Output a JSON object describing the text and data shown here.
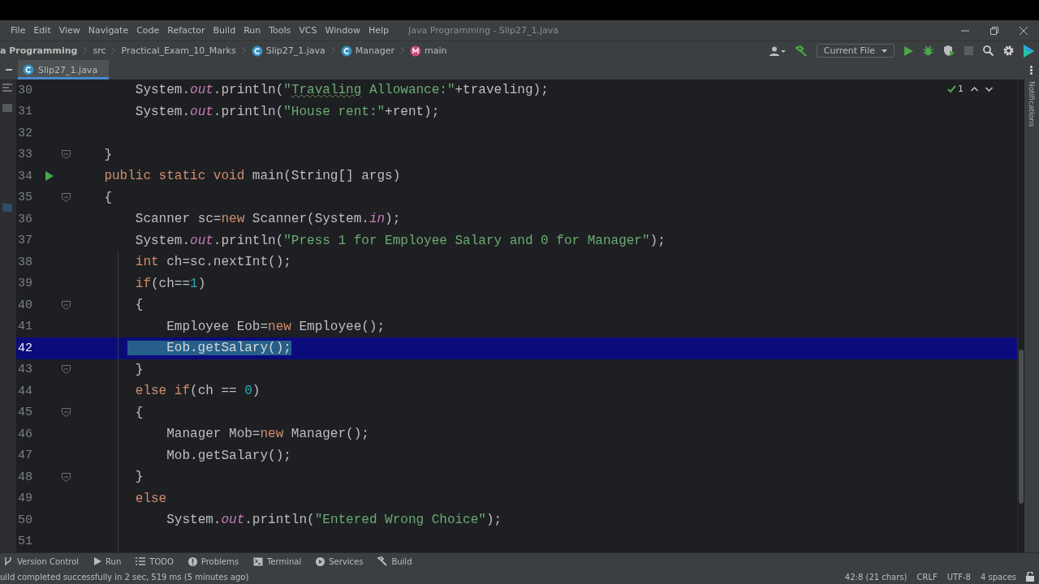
{
  "menu": [
    "File",
    "Edit",
    "View",
    "Navigate",
    "Code",
    "Refactor",
    "Build",
    "Run",
    "Tools",
    "VCS",
    "Window",
    "Help"
  ],
  "window": {
    "title": "Java Programming - Slip27_1.java"
  },
  "breadcrumbs": [
    {
      "label": "a Programming",
      "kind": "project"
    },
    {
      "label": "src",
      "kind": "folder"
    },
    {
      "label": "Practical_Exam_10_Marks",
      "kind": "folder"
    },
    {
      "label": "Slip27_1.java",
      "kind": "class"
    },
    {
      "label": "Manager",
      "kind": "class"
    },
    {
      "label": "main",
      "kind": "method"
    }
  ],
  "run_config": "Current File",
  "tabs": [
    {
      "label": "Slip27_1.java",
      "selected": true
    }
  ],
  "inspection": {
    "count": "1"
  },
  "lines": [
    {
      "number": "30",
      "kind": "plain",
      "selected": false,
      "tokens": [
        {
          "text": "        System.",
          "kind": "plain"
        },
        {
          "text": "out",
          "kind": "field"
        },
        {
          "text": ".println(",
          "kind": "plain"
        },
        {
          "text": "\"",
          "kind": "string"
        },
        {
          "text": "Travaling",
          "kind": "typo"
        },
        {
          "text": " Allowance:\"",
          "kind": "string"
        },
        {
          "text": "+traveling);",
          "kind": "plain"
        }
      ]
    },
    {
      "number": "31",
      "kind": "plain",
      "selected": false,
      "tokens": [
        {
          "text": "        System.",
          "kind": "plain"
        },
        {
          "text": "out",
          "kind": "field"
        },
        {
          "text": ".println(",
          "kind": "plain"
        },
        {
          "text": "\"House rent:\"",
          "kind": "string"
        },
        {
          "text": "+rent);",
          "kind": "plain"
        }
      ]
    },
    {
      "number": "32",
      "kind": "plain",
      "selected": false
    },
    {
      "number": "33",
      "kind": "fold",
      "selected": false,
      "tokens": [
        {
          "text": "    }",
          "kind": "plain"
        }
      ]
    },
    {
      "number": "34",
      "kind": "run",
      "selected": false,
      "tokens": [
        {
          "text": "    public static void ",
          "kind": "keyword"
        },
        {
          "text": "main(String[] args)",
          "kind": "plain"
        }
      ]
    },
    {
      "number": "35",
      "kind": "fold",
      "selected": false,
      "tokens": [
        {
          "text": "    {",
          "kind": "plain"
        }
      ]
    },
    {
      "number": "36",
      "kind": "plain",
      "selected": false,
      "tokens": [
        {
          "text": "        Scanner sc=",
          "kind": "plain"
        },
        {
          "text": "new ",
          "kind": "keyword"
        },
        {
          "text": "Scanner(System.",
          "kind": "plain"
        },
        {
          "text": "in",
          "kind": "field"
        },
        {
          "text": ");",
          "kind": "plain"
        }
      ]
    },
    {
      "number": "37",
      "kind": "plain",
      "selected": false,
      "tokens": [
        {
          "text": "        System.",
          "kind": "plain"
        },
        {
          "text": "out",
          "kind": "field"
        },
        {
          "text": ".println(",
          "kind": "plain"
        },
        {
          "text": "\"Press 1 for Employee Salary and 0 for Manager\"",
          "kind": "string"
        },
        {
          "text": ");",
          "kind": "plain"
        }
      ]
    },
    {
      "number": "38",
      "kind": "plain",
      "selected": false,
      "tokens": [
        {
          "text": "        int ",
          "kind": "keyword"
        },
        {
          "text": "ch=sc.nextInt();",
          "kind": "plain"
        }
      ]
    },
    {
      "number": "39",
      "kind": "plain",
      "selected": false,
      "tokens": [
        {
          "text": "        if",
          "kind": "keyword"
        },
        {
          "text": "(ch==",
          "kind": "plain"
        },
        {
          "text": "1",
          "kind": "number"
        },
        {
          "text": ")",
          "kind": "plain"
        }
      ]
    },
    {
      "number": "40",
      "kind": "fold",
      "selected": false,
      "tokens": [
        {
          "text": "        {",
          "kind": "plain"
        }
      ]
    },
    {
      "number": "41",
      "kind": "plain",
      "selected": false,
      "tokens": [
        {
          "text": "            Employee Eob=",
          "kind": "plain"
        },
        {
          "text": "new ",
          "kind": "keyword"
        },
        {
          "text": "Employee();",
          "kind": "plain"
        }
      ]
    },
    {
      "number": "42",
      "kind": "plain",
      "selected": true,
      "tokens": [
        {
          "text": "     Eob.getSalary();",
          "kind": "selection"
        }
      ]
    },
    {
      "number": "43",
      "kind": "fold",
      "selected": false,
      "tokens": [
        {
          "text": "        }",
          "kind": "plain"
        }
      ]
    },
    {
      "number": "44",
      "kind": "plain",
      "selected": false,
      "tokens": [
        {
          "text": "        else if",
          "kind": "keyword"
        },
        {
          "text": "(ch == ",
          "kind": "plain"
        },
        {
          "text": "0",
          "kind": "number"
        },
        {
          "text": ")",
          "kind": "plain"
        }
      ]
    },
    {
      "number": "45",
      "kind": "fold",
      "selected": false,
      "tokens": [
        {
          "text": "        {",
          "kind": "plain"
        }
      ]
    },
    {
      "number": "46",
      "kind": "plain",
      "selected": false,
      "tokens": [
        {
          "text": "            Manager Mob=",
          "kind": "plain"
        },
        {
          "text": "new ",
          "kind": "keyword"
        },
        {
          "text": "Manager();",
          "kind": "plain"
        }
      ]
    },
    {
      "number": "47",
      "kind": "plain",
      "selected": false,
      "tokens": [
        {
          "text": "            Mob.getSalary();",
          "kind": "plain"
        }
      ]
    },
    {
      "number": "48",
      "kind": "fold",
      "selected": false,
      "tokens": [
        {
          "text": "        }",
          "kind": "plain"
        }
      ]
    },
    {
      "number": "49",
      "kind": "plain",
      "selected": false,
      "tokens": [
        {
          "text": "        else",
          "kind": "keyword"
        }
      ]
    },
    {
      "number": "50",
      "kind": "plain",
      "selected": false,
      "tokens": [
        {
          "text": "            System.",
          "kind": "plain"
        },
        {
          "text": "out",
          "kind": "field"
        },
        {
          "text": ".println(",
          "kind": "plain"
        },
        {
          "text": "\"Entered Wrong Choice\"",
          "kind": "string"
        },
        {
          "text": ");",
          "kind": "plain"
        }
      ]
    },
    {
      "number": "51",
      "kind": "plain",
      "selected": false
    }
  ],
  "notifications_label": "Notifications",
  "tool_windows": [
    {
      "label": "Version Control",
      "kind": "vcs"
    },
    {
      "label": "Run",
      "kind": "run"
    },
    {
      "label": "TODO",
      "kind": "todo"
    },
    {
      "label": "Problems",
      "kind": "problems"
    },
    {
      "label": "Terminal",
      "kind": "terminal"
    },
    {
      "label": "Services",
      "kind": "services"
    },
    {
      "label": "Build",
      "kind": "build"
    }
  ],
  "status_bar": {
    "message": "uild completed successfully in 2 sec, 519 ms (5 minutes ago)",
    "items": [
      "42:8 (21 chars)",
      "CRLF",
      "UTF-8",
      "4 spaces"
    ]
  }
}
